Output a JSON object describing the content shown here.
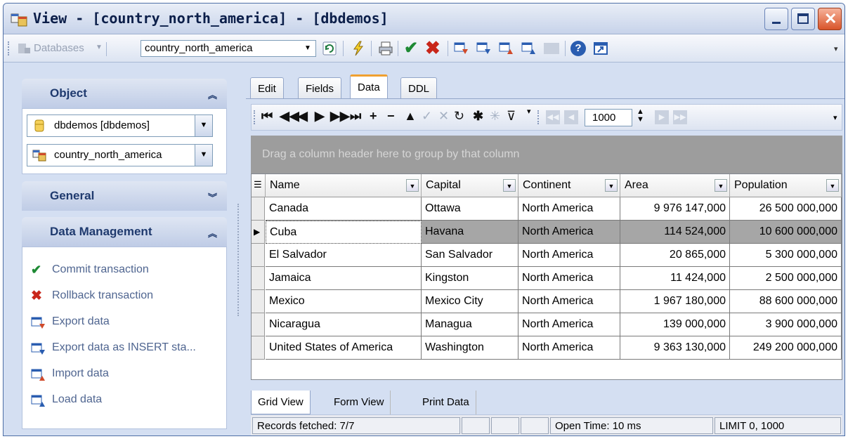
{
  "window": {
    "title": "View - [country_north_america] - [dbdemos]"
  },
  "toolbar": {
    "databases_label": "Databases",
    "object_value": "country_north_america"
  },
  "left_panel": {
    "object_header": "Object",
    "database_combo": "dbdemos [dbdemos]",
    "object_combo": "country_north_america",
    "general_header": "General",
    "data_management_header": "Data Management",
    "data_management_items": [
      {
        "label": "Commit transaction",
        "icon": "check-icon"
      },
      {
        "label": "Rollback transaction",
        "icon": "x-icon"
      },
      {
        "label": "Export data",
        "icon": "export-icon"
      },
      {
        "label": "Export data as INSERT sta...",
        "icon": "export-insert-icon"
      },
      {
        "label": "Import data",
        "icon": "import-icon"
      },
      {
        "label": "Load data",
        "icon": "load-icon"
      }
    ]
  },
  "tabs": {
    "edit": "Edit",
    "fields": "Fields",
    "data": "Data",
    "ddl": "DDL"
  },
  "navigator": {
    "limit_value": "1000"
  },
  "grid": {
    "group_hint": "Drag a column header here to group by that column",
    "columns": [
      "Name",
      "Capital",
      "Continent",
      "Area",
      "Population"
    ],
    "rows": [
      [
        "Canada",
        "Ottawa",
        "North America",
        "9 976 147,000",
        "26 500 000,000"
      ],
      [
        "Cuba",
        "Havana",
        "North America",
        "114 524,000",
        "10 600 000,000"
      ],
      [
        "El Salvador",
        "San Salvador",
        "North America",
        "20 865,000",
        "5 300 000,000"
      ],
      [
        "Jamaica",
        "Kingston",
        "North America",
        "11 424,000",
        "2 500 000,000"
      ],
      [
        "Mexico",
        "Mexico City",
        "North America",
        "1 967 180,000",
        "88 600 000,000"
      ],
      [
        "Nicaragua",
        "Managua",
        "North America",
        "139 000,000",
        "3 900 000,000"
      ],
      [
        "United States of America",
        "Washington",
        "North America",
        "9 363 130,000",
        "249 200 000,000"
      ]
    ],
    "selected_row": 1
  },
  "bottom_tabs": {
    "grid_view": "Grid View",
    "form_view": "Form View",
    "print_data": "Print Data"
  },
  "status": {
    "records": "Records fetched: 7/7",
    "open_time": "Open Time: 10 ms",
    "limit": "LIMIT 0, 1000"
  }
}
